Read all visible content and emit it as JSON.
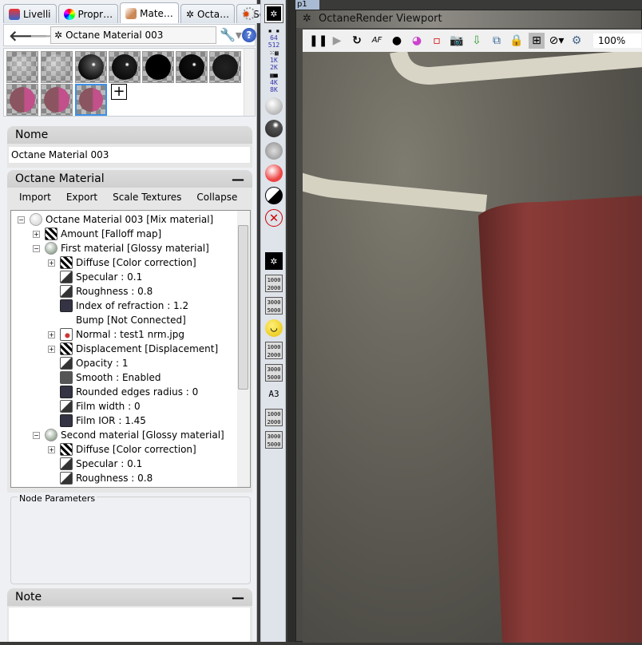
{
  "tabs": [
    {
      "label": "Livelli",
      "icon": "layers-icon"
    },
    {
      "label": "Propr…",
      "icon": "color-wheel-icon"
    },
    {
      "label": "Mate…",
      "icon": "material-icon",
      "active": true
    },
    {
      "label": "Octa…",
      "icon": "octane-icon"
    },
    {
      "label": "Sole",
      "icon": "sun-icon"
    }
  ],
  "nav": {
    "path": "Octane Material 003"
  },
  "swatches": [
    "transparent",
    "transparent",
    "black-glossy",
    "black-glossy",
    "black",
    "black-glossy",
    "black-noisy",
    "pink",
    "pink",
    "pink-selected"
  ],
  "nome": {
    "title": "Nome",
    "value": "Octane Material 003"
  },
  "octane": {
    "title": "Octane Material",
    "actions": [
      "Import",
      "Export",
      "Scale Textures",
      "Collapse"
    ]
  },
  "tree": [
    {
      "indent": 0,
      "label": "Octane Material 003  [Mix material]",
      "icon": "white",
      "exp": "-"
    },
    {
      "indent": 1,
      "label": "Amount  [Falloff map]",
      "icon": "stripe",
      "exp": "+"
    },
    {
      "indent": 1,
      "label": "First material  [Glossy material]",
      "icon": "ball",
      "exp": "-"
    },
    {
      "indent": 2,
      "label": "Diffuse  [Color correction]",
      "icon": "stripe",
      "exp": "+"
    },
    {
      "indent": 2,
      "label": "Specular : 0.1",
      "icon": "grad"
    },
    {
      "indent": 2,
      "label": "Roughness : 0.8",
      "icon": "grad"
    },
    {
      "indent": 2,
      "label": "Index of refraction : 1.2",
      "icon": "curve"
    },
    {
      "indent": 2,
      "label": "Bump  [Not Connected]",
      "icon": "none"
    },
    {
      "indent": 2,
      "label": "Normal : test1 nrm.jpg",
      "icon": "normal",
      "exp": "+"
    },
    {
      "indent": 2,
      "label": "Displacement  [Displacement]",
      "icon": "stripe",
      "exp": "+"
    },
    {
      "indent": 2,
      "label": "Opacity : 1",
      "icon": "grad"
    },
    {
      "indent": 2,
      "label": "Smooth : Enabled",
      "icon": "smooth"
    },
    {
      "indent": 2,
      "label": "Rounded edges radius : 0",
      "icon": "curve"
    },
    {
      "indent": 2,
      "label": "Film width : 0",
      "icon": "grad"
    },
    {
      "indent": 2,
      "label": "Film IOR : 1.45",
      "icon": "curve"
    },
    {
      "indent": 1,
      "label": "Second material  [Glossy material]",
      "icon": "ball",
      "exp": "-"
    },
    {
      "indent": 2,
      "label": "Diffuse  [Color correction]",
      "icon": "stripe",
      "exp": "+"
    },
    {
      "indent": 2,
      "label": "Specular : 0.1",
      "icon": "grad"
    },
    {
      "indent": 2,
      "label": "Roughness : 0.8",
      "icon": "grad"
    }
  ],
  "node_params": {
    "title": "Node Parameters"
  },
  "note": {
    "title": "Note"
  },
  "strip": {
    "res1": "64",
    "res2": "512",
    "res3": "1K",
    "res4": "2K",
    "res5": "4K",
    "res6": "8K",
    "r1000": "1000",
    "r2000": "2000",
    "r3000": "3000",
    "r5000": "5000",
    "a3": "A3"
  },
  "viewport": {
    "tab": "p1",
    "title": "OctaneRender Viewport",
    "zoom": "100%"
  }
}
